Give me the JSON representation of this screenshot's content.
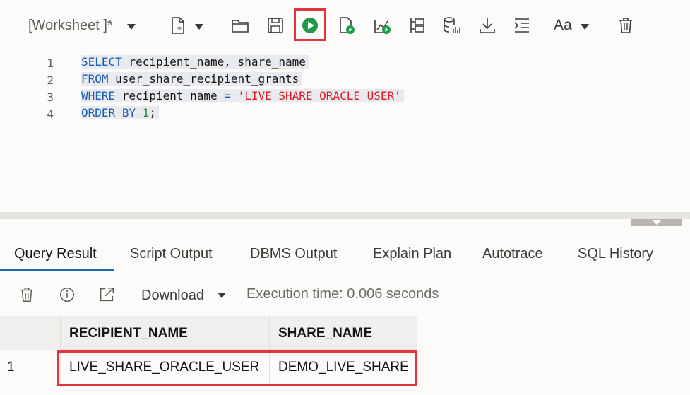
{
  "toolbar": {
    "worksheet_title": "[Worksheet ]*",
    "font_label": "Aa",
    "icons": [
      "new-file-icon",
      "open-folder-icon",
      "save-icon",
      "run-statement-icon",
      "run-script-icon",
      "autotrace-icon",
      "explain-plan-icon",
      "database-icon",
      "download-icon",
      "format-icon",
      "font-icon",
      "trash-icon"
    ],
    "accent_highlight": "#e0353d",
    "run_color": "#1e9b48"
  },
  "editor": {
    "line_numbers": [
      "1",
      "2",
      "3",
      "4"
    ],
    "lines": [
      [
        {
          "t": "kw",
          "v": "SELECT"
        },
        {
          "t": "txt",
          "v": " recipient_name, share_name"
        }
      ],
      [
        {
          "t": "kw",
          "v": "FROM"
        },
        {
          "t": "txt",
          "v": " user_share_recipient_grants"
        }
      ],
      [
        {
          "t": "kw",
          "v": "WHERE"
        },
        {
          "t": "txt",
          "v": " recipient_name "
        },
        {
          "t": "kw",
          "v": "="
        },
        {
          "t": "txt",
          "v": " "
        },
        {
          "t": "str",
          "v": "'LIVE_SHARE_ORACLE_USER'"
        }
      ],
      [
        {
          "t": "kw",
          "v": "ORDER"
        },
        {
          "t": "txt",
          "v": " "
        },
        {
          "t": "kw",
          "v": "BY"
        },
        {
          "t": "txt",
          "v": " "
        },
        {
          "t": "num",
          "v": "1"
        },
        {
          "t": "txt",
          "v": ";"
        }
      ]
    ]
  },
  "tabs": {
    "items": [
      "Query Result",
      "Script Output",
      "DBMS Output",
      "Explain Plan",
      "Autotrace",
      "SQL History"
    ],
    "active": "Query Result"
  },
  "result_toolbar": {
    "download_label": "Download",
    "execution_time": "Execution time: 0.006 seconds"
  },
  "grid": {
    "columns": [
      "RECIPIENT_NAME",
      "SHARE_NAME"
    ],
    "rows": [
      {
        "num": "1",
        "cells": [
          "LIVE_SHARE_ORACLE_USER",
          "DEMO_LIVE_SHARE"
        ]
      }
    ]
  }
}
